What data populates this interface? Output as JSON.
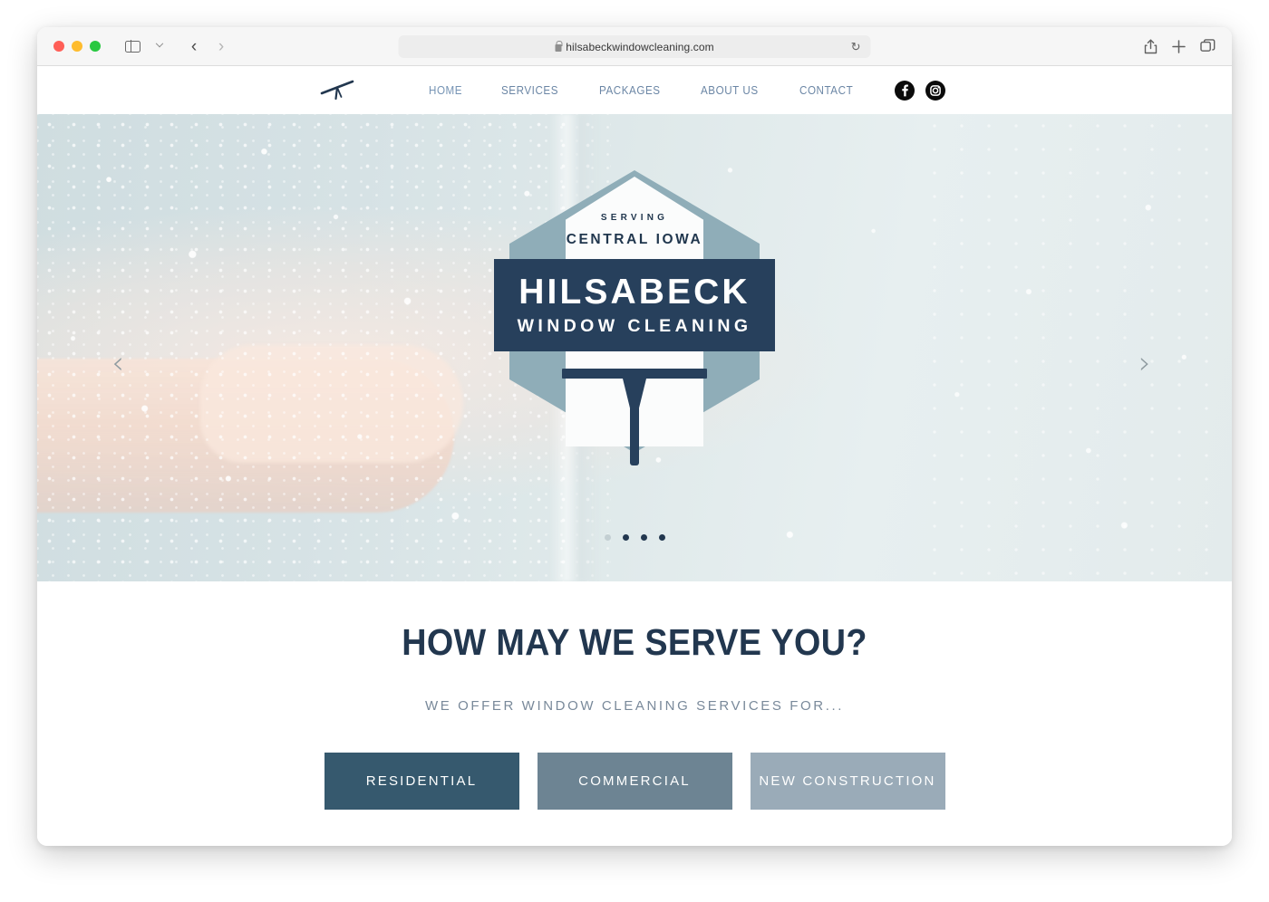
{
  "browser": {
    "url": "hilsabeckwindowcleaning.com",
    "lock_icon": "lock-icon",
    "reload_icon": "↻",
    "traffic_lights": [
      "close",
      "minimize",
      "maximize"
    ],
    "sidebar_icon": "sidebar-icon",
    "back_icon": "‹",
    "forward_icon": "›",
    "share_icon": "share-icon",
    "new_tab_icon": "plus-icon",
    "tabs_icon": "tabs-overview-icon"
  },
  "site": {
    "nav": {
      "logo_icon": "squeegee-logo-icon",
      "links": [
        {
          "label": "HOME",
          "active": true
        },
        {
          "label": "SERVICES",
          "active": false
        },
        {
          "label": "PACKAGES",
          "active": false
        },
        {
          "label": "ABOUT US",
          "active": false
        },
        {
          "label": "CONTACT",
          "active": false
        }
      ],
      "social": [
        {
          "name": "facebook-icon",
          "glyph": "f"
        },
        {
          "name": "instagram-icon",
          "glyph": "◎"
        }
      ]
    },
    "hero": {
      "badge": {
        "serving": "SERVING",
        "region": "CENTRAL IOWA",
        "brand_name": "HILSABECK",
        "brand_tagline": "WINDOW CLEANING"
      },
      "prev_arrow": "‹",
      "next_arrow": "›",
      "dots": [
        {
          "active": false
        },
        {
          "active": true
        },
        {
          "active": true
        },
        {
          "active": true
        }
      ]
    },
    "services": {
      "title": "HOW MAY WE SERVE YOU?",
      "subtitle": "WE OFFER WINDOW CLEANING SERVICES FOR...",
      "buttons": [
        {
          "label": "RESIDENTIAL",
          "color": "#36596e"
        },
        {
          "label": "COMMERCIAL",
          "color": "#6d8493"
        },
        {
          "label": "NEW CONSTRUCTION",
          "color": "#9aabb8"
        }
      ]
    }
  },
  "colors": {
    "brand_navy": "#27405c",
    "brand_slate": "#8fadb8",
    "nav_link": "#6b86a5",
    "heading": "#22374f"
  }
}
